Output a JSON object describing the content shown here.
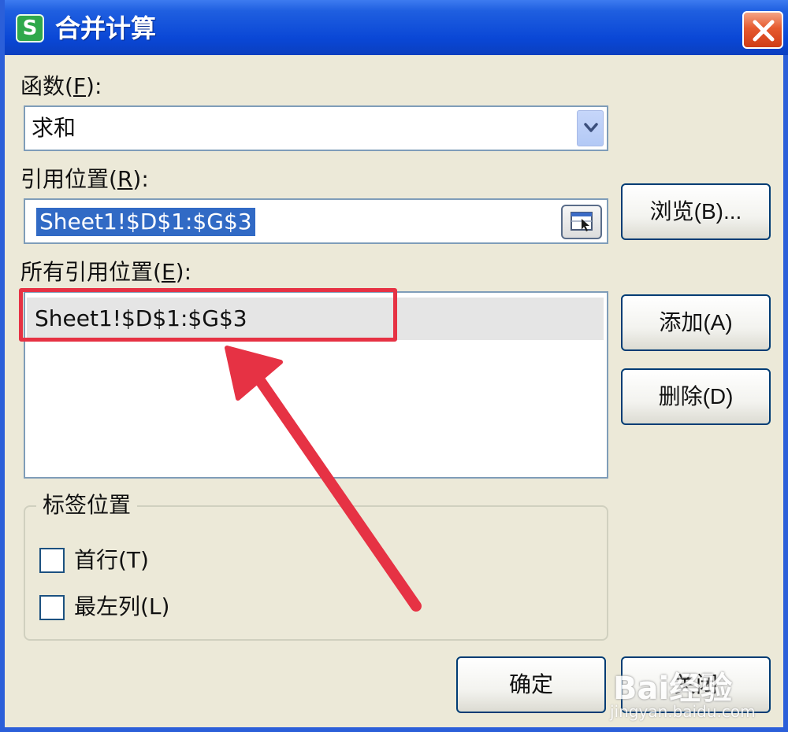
{
  "window": {
    "title": "合并计算",
    "app_icon_letter": "S",
    "close_icon": "close-icon"
  },
  "function": {
    "label": "函数(",
    "label_key": "F",
    "label_end": "):",
    "value": "求和",
    "dropdown_icon": "chevron-down-icon"
  },
  "reference": {
    "label": "引用位置(",
    "label_key": "R",
    "label_end": "):",
    "value": "Sheet1!$D$1:$G$3",
    "picker_icon": "range-picker-icon"
  },
  "all_references": {
    "label": "所有引用位置(",
    "label_key": "E",
    "label_end": "):",
    "items": [
      "Sheet1!$D$1:$G$3"
    ]
  },
  "buttons": {
    "browse": "浏览(B)...",
    "add": "添加(A)",
    "delete": "删除(D)",
    "ok": "确定",
    "close": "关闭"
  },
  "label_position": {
    "legend": "标签位置",
    "top_row": "首行(T)",
    "left_column": "最左列(L)",
    "top_row_checked": false,
    "left_column_checked": false
  },
  "annotation": {
    "highlight_color": "#e63244"
  },
  "watermark": {
    "brand": "Bai经验",
    "url": "jingyan.baidu.com"
  }
}
